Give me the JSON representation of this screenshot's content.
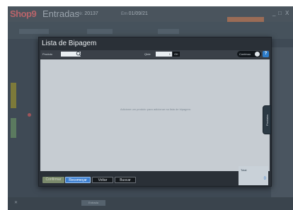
{
  "app": {
    "logo_left": "Shop",
    "logo_right": "9",
    "title": "Entradas",
    "number_label": "Nr.",
    "number_value": "20137",
    "date_label": "Em",
    "date_value": "01/09/21",
    "window_controls": [
      "_",
      "□",
      "X"
    ],
    "bottom_button": "Entrada"
  },
  "modal": {
    "title": "Lista de Bipagem",
    "product_label": "Produto",
    "search_value": "",
    "qty_label": "Qtde",
    "qty_value": "1",
    "ok_label": "OK",
    "toggle_label": "Contínuo",
    "help_label": "?",
    "empty_message": "Adicione um produto para adicionar na lista de bipagem.",
    "products_tab": "Produtos",
    "total_label": "Total",
    "total_value": "0",
    "buttons": {
      "confirm": "Confirmar",
      "restart": "Recomeçar",
      "back": "Voltar",
      "search": "Buscar"
    }
  }
}
